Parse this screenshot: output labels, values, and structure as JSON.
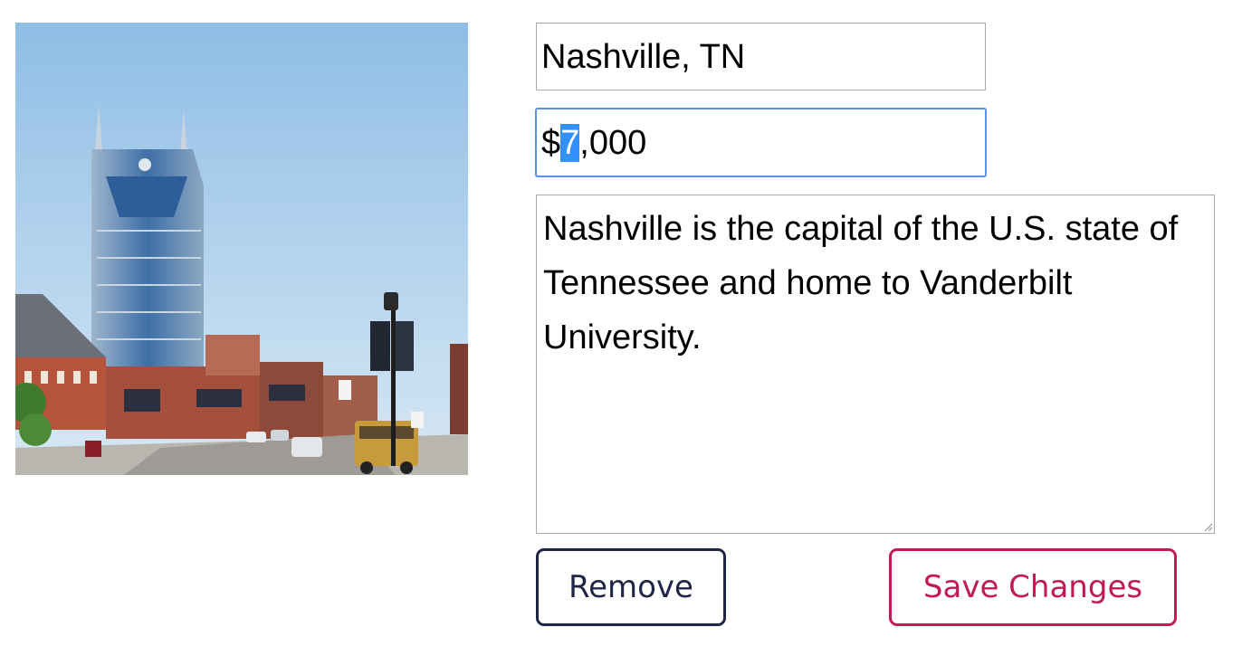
{
  "listing": {
    "image_subject": "Nashville skyline street photo",
    "name_value": "Nashville, TN",
    "price_prefix": "$",
    "price_selected": "7",
    "price_suffix": ",000",
    "description": "Nashville is the capital of the U.S. state of Tennessee and home to Vanderbilt University."
  },
  "actions": {
    "remove_label": "Remove",
    "save_label": "Save Changes"
  },
  "colors": {
    "remove_border": "#1f2545",
    "save_accent": "#c21a55",
    "focus_ring": "#5b91e8",
    "selection": "#3390ff"
  }
}
